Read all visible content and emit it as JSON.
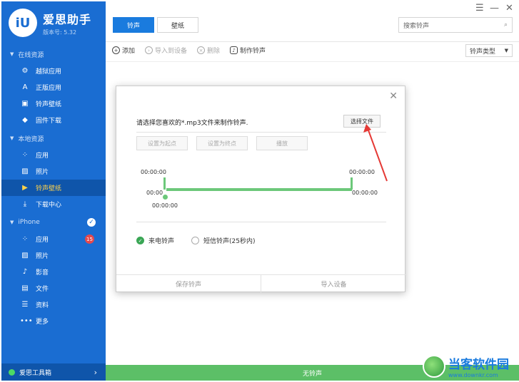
{
  "app": {
    "title": "爱思助手",
    "version": "版本号: 5.32"
  },
  "sidebar": {
    "online_section": "在线资源",
    "online_items": [
      {
        "label": "越狱应用",
        "icon": "gear-icon"
      },
      {
        "label": "正版应用",
        "icon": "appstore-icon"
      },
      {
        "label": "铃声壁纸",
        "icon": "ringtone-icon"
      },
      {
        "label": "固件下载",
        "icon": "box-icon"
      }
    ],
    "local_section": "本地资源",
    "local_items": [
      {
        "label": "应用",
        "icon": "apps-icon"
      },
      {
        "label": "照片",
        "icon": "photo-icon"
      },
      {
        "label": "铃声壁纸",
        "icon": "ringtone-icon"
      },
      {
        "label": "下载中心",
        "icon": "download-icon"
      }
    ],
    "device_section": "iPhone",
    "device_items": [
      {
        "label": "应用",
        "icon": "apps-icon",
        "badge": "15"
      },
      {
        "label": "照片",
        "icon": "photo-icon"
      },
      {
        "label": "影音",
        "icon": "music-icon"
      },
      {
        "label": "文件",
        "icon": "file-icon"
      },
      {
        "label": "资料",
        "icon": "list-icon"
      },
      {
        "label": "更多",
        "icon": "more-icon"
      }
    ],
    "toolbox": "爱思工具箱"
  },
  "tabs": {
    "ringtone": "铃声",
    "wallpaper": "壁纸"
  },
  "search": {
    "placeholder": "搜索铃声"
  },
  "actions": {
    "add": "添加",
    "import": "导入到设备",
    "delete": "删除",
    "make": "制作铃声"
  },
  "type_select": {
    "value": "铃声类型"
  },
  "modal": {
    "prompt": "请选择您喜欢的*.mp3文件来制作铃声.",
    "choose_file": "选择文件",
    "set_start": "设置为起点",
    "set_end": "设置为终点",
    "play": "播放",
    "time_start_top": "00:00:00",
    "time_end_top": "00:00:00",
    "time_left_mid": "00:00",
    "time_right_mid": "00:00:00",
    "time_bottom": "00:00:00",
    "radio_call": "来电铃声",
    "radio_sms": "短信铃声(25秒内)",
    "save": "保存铃声",
    "import": "导入设备"
  },
  "status": {
    "text": "无铃声"
  },
  "watermark": {
    "title": "当客软件园",
    "url": "www.downkr.com"
  },
  "colors": {
    "sidebar": "#1a6dd2",
    "accent": "#1a7bde",
    "green": "#5cbf67"
  }
}
